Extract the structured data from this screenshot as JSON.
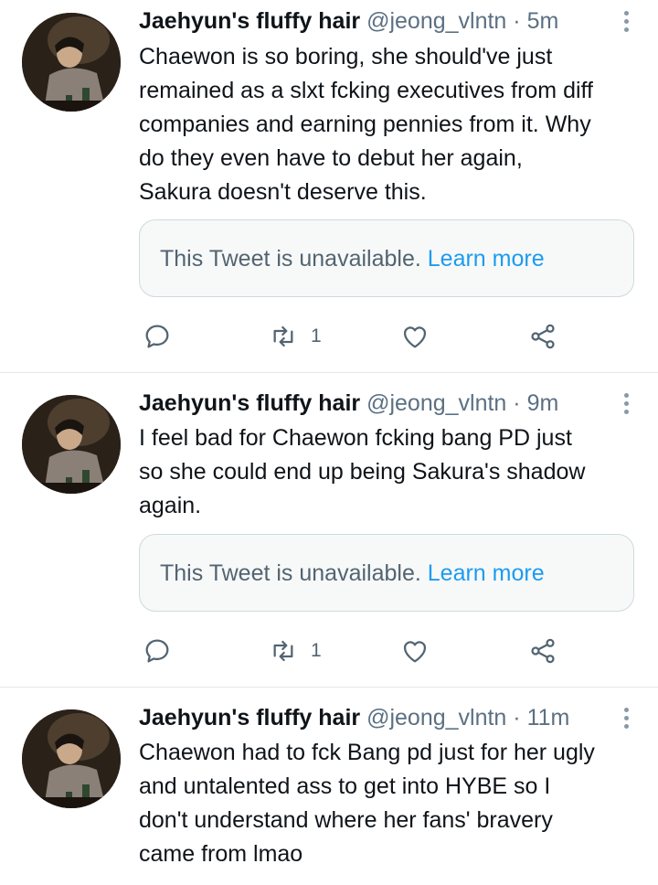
{
  "tweets": [
    {
      "name": "Jaehyun's fluffy hair",
      "handle": "@jeong_vlntn",
      "separator": "·",
      "time": "5m",
      "lines": [
        "Chaewon is so boring, she should've just",
        "remained as a slxt fcking executives from diff",
        "companies and earning pennies from it. Why",
        "do they even have to debut her again,",
        "Sakura doesn't deserve this."
      ],
      "quote_text": "This Tweet is unavailable.",
      "quote_link": "Learn more",
      "retweets": "1"
    },
    {
      "name": "Jaehyun's fluffy hair",
      "handle": "@jeong_vlntn",
      "separator": "·",
      "time": "9m",
      "lines": [
        "I feel bad for Chaewon fcking bang PD just",
        "so she could end up being Sakura's shadow",
        "again."
      ],
      "quote_text": "This Tweet is unavailable.",
      "quote_link": "Learn more",
      "retweets": "1"
    },
    {
      "name": "Jaehyun's fluffy hair",
      "handle": "@jeong_vlntn",
      "separator": "·",
      "time": "11m",
      "lines": [
        "Chaewon had to fck Bang pd just for her ugly",
        "and untalented ass to get into HYBE so I",
        "don't understand where her fans' bravery",
        "came from lmao"
      ]
    }
  ],
  "icons": {
    "reply": "reply-icon",
    "retweet": "retweet-icon",
    "like": "heart-icon",
    "share": "share-icon",
    "more": "more-vertical-icon"
  },
  "colors": {
    "text": "#0f1419",
    "muted": "#5b7083",
    "link": "#1d9bf0",
    "quote_bg": "#f7f9f9",
    "border": "#cfd9de"
  }
}
